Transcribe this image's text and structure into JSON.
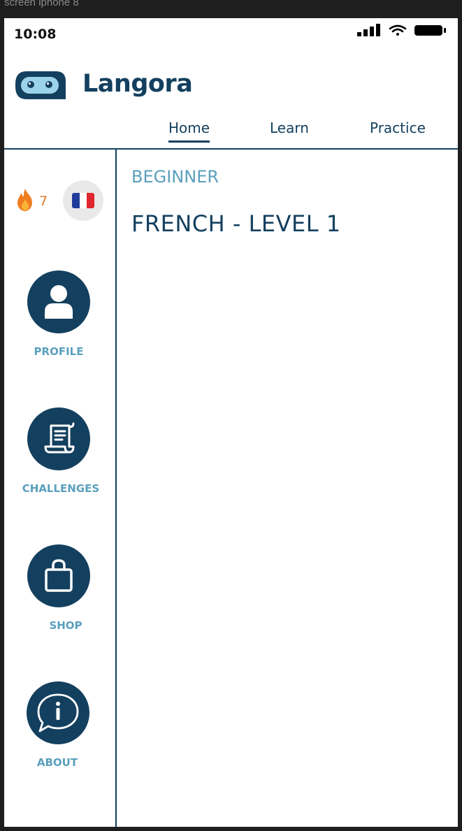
{
  "frame": {
    "label": "screen iphone 8"
  },
  "status_bar": {
    "time": "10:08"
  },
  "header": {
    "app_name": "Langora",
    "tabs": [
      {
        "label": "Home",
        "active": true
      },
      {
        "label": "Learn",
        "active": false
      },
      {
        "label": "Practice",
        "active": false
      }
    ]
  },
  "sidebar": {
    "streak": {
      "icon": "fire-icon",
      "count": "7"
    },
    "language_flag": {
      "icon": "france-flag-icon",
      "colors": [
        "#1f3c9a",
        "#ffffff",
        "#e0262e"
      ]
    },
    "items": [
      {
        "label": "PROFILE",
        "icon": "user-icon"
      },
      {
        "label": "CHALLENGES",
        "icon": "scroll-icon"
      },
      {
        "label": "SHOP",
        "icon": "shopping-bag-icon"
      },
      {
        "label": "ABOUT",
        "icon": "info-speech-bubble-icon"
      }
    ]
  },
  "main": {
    "level": "BEGINNER",
    "course_title": "FRENCH - LEVEL 1"
  },
  "colors": {
    "primary": "#14405f",
    "accent": "#5b9fbd",
    "streak": "#e07b2a",
    "logo_face": "#9ad3ea"
  }
}
